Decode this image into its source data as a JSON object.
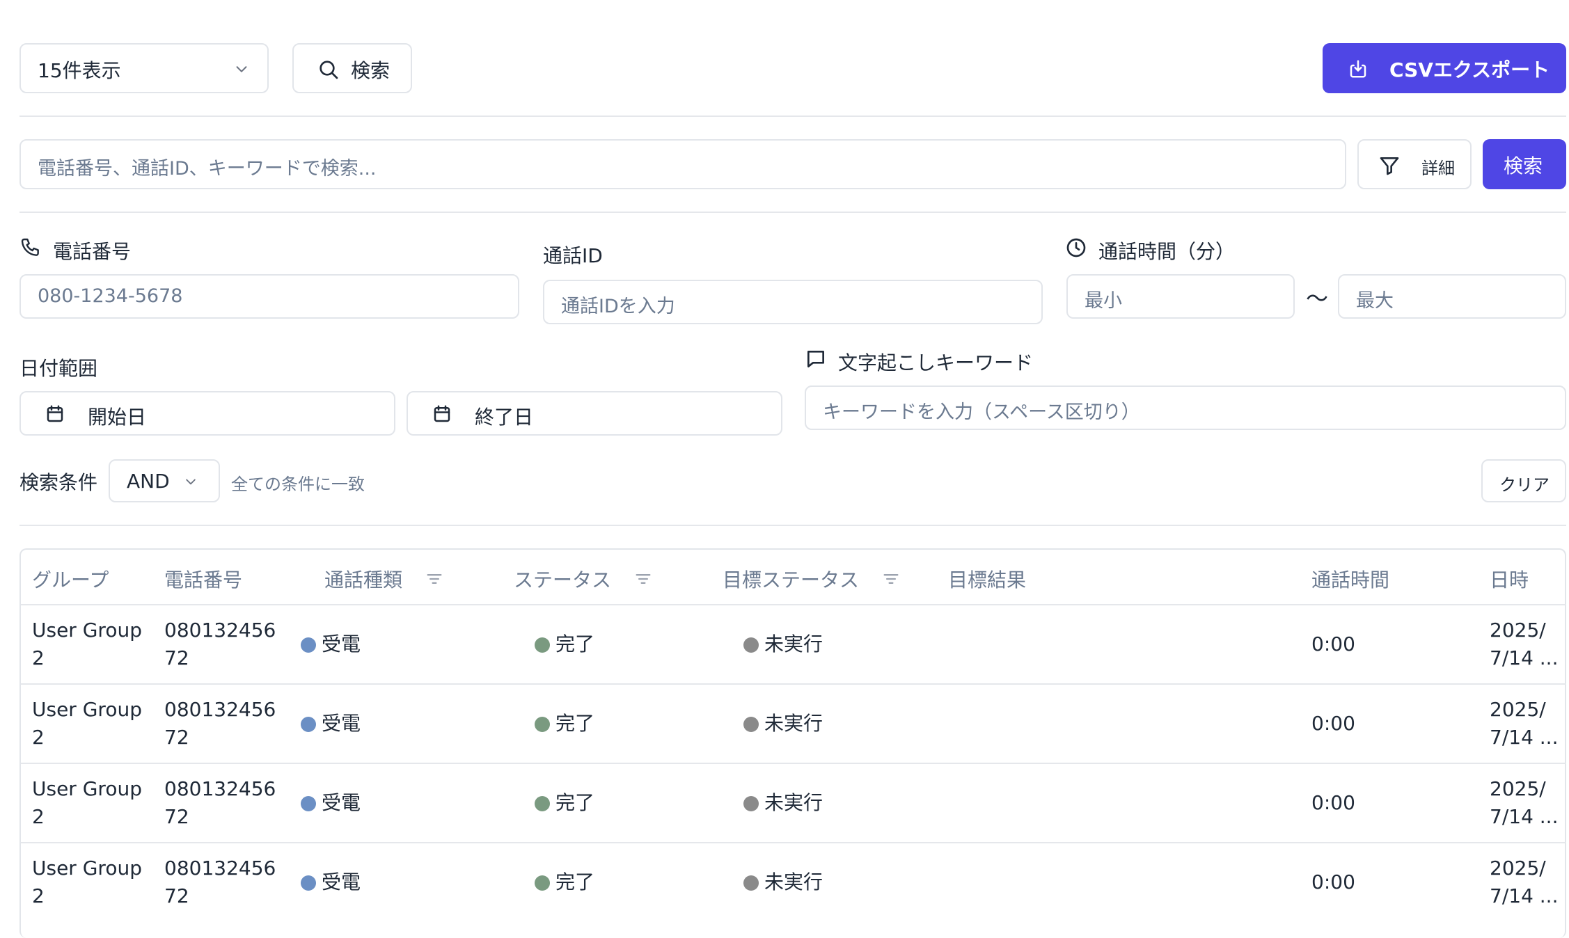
{
  "toolbar": {
    "page_size": "15件表示",
    "search_label": "検索",
    "export_label": "CSVエクスポート"
  },
  "search": {
    "placeholder": "電話番号、通話ID、キーワードで検索...",
    "details_label": "詳細",
    "submit_label": "検索"
  },
  "filters": {
    "phone_label": "電話番号",
    "phone_placeholder": "080-1234-5678",
    "call_id_label": "通話ID",
    "call_id_placeholder": "通話IDを入力",
    "duration_label": "通話時間（分）",
    "duration_min_placeholder": "最小",
    "duration_sep": "〜",
    "duration_max_placeholder": "最大",
    "date_label": "日付範囲",
    "start_date": "開始日",
    "end_date": "終了日",
    "keyword_label": "文字起こしキーワード",
    "keyword_placeholder": "キーワードを入力（スペース区切り）",
    "condition_label": "検索条件",
    "condition_value": "AND",
    "condition_hint": "全ての条件に一致",
    "clear_label": "クリア"
  },
  "table": {
    "headers": {
      "group": "グループ",
      "phone": "電話番号",
      "call_type": "通話種類",
      "status": "ステータス",
      "goal_status": "目標ステータス",
      "goal_result": "目標結果",
      "duration": "通話時間",
      "datetime": "日時"
    },
    "rows": [
      {
        "group_l1": "User Group",
        "group_l2": "2",
        "phone_l1": "080132456",
        "phone_l2": "72",
        "call_type": "受電",
        "status": "完了",
        "goal_status": "未実行",
        "goal_result": "",
        "duration": "0:00",
        "date_l1": "2025/",
        "date_l2": "7/14 ..."
      },
      {
        "group_l1": "User Group",
        "group_l2": "2",
        "phone_l1": "080132456",
        "phone_l2": "72",
        "call_type": "受電",
        "status": "完了",
        "goal_status": "未実行",
        "goal_result": "",
        "duration": "0:00",
        "date_l1": "2025/",
        "date_l2": "7/14 ..."
      },
      {
        "group_l1": "User Group",
        "group_l2": "2",
        "phone_l1": "080132456",
        "phone_l2": "72",
        "call_type": "受電",
        "status": "完了",
        "goal_status": "未実行",
        "goal_result": "",
        "duration": "0:00",
        "date_l1": "2025/",
        "date_l2": "7/14 ..."
      },
      {
        "group_l1": "User Group",
        "group_l2": "2",
        "phone_l1": "080132456",
        "phone_l2": "72",
        "call_type": "受電",
        "status": "完了",
        "goal_status": "未実行",
        "goal_result": "",
        "duration": "0:00",
        "date_l1": "2025/",
        "date_l2": "7/14 ..."
      }
    ]
  },
  "colors": {
    "accent": "#4f46e5",
    "call_type_dot": "#6b8fc4",
    "status_dot": "#7a9a80",
    "goal_status_dot": "#8a8a8a"
  }
}
